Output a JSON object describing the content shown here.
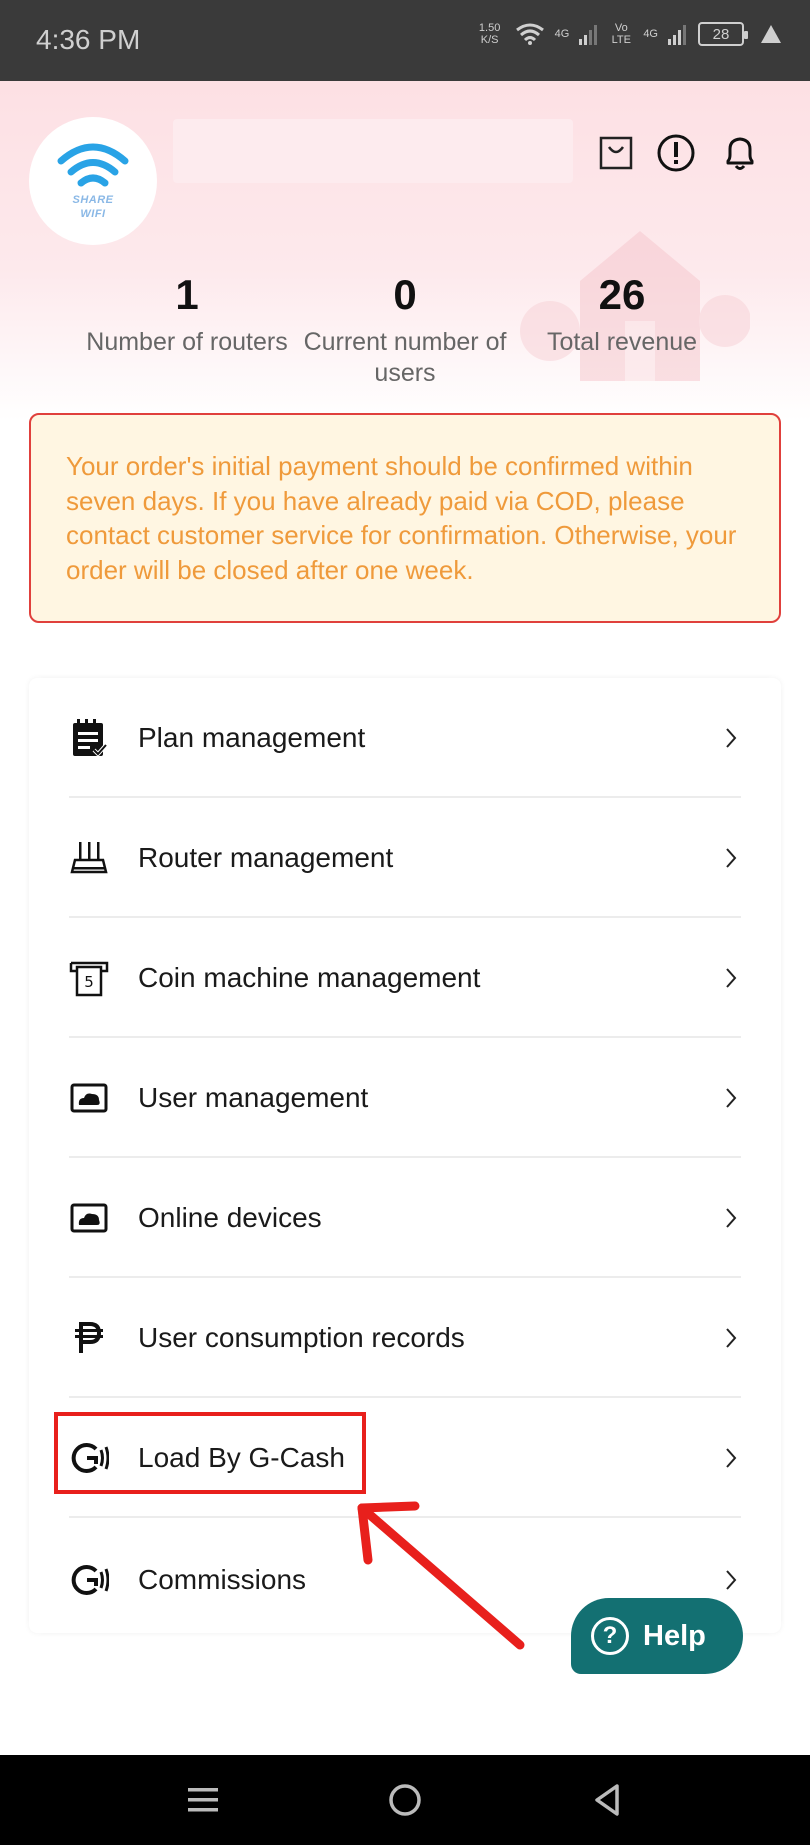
{
  "status_bar": {
    "time": "4:36 PM",
    "net_speed_value": "1.50",
    "net_speed_unit": "K/S",
    "sim1_label": "4G",
    "volte_label": "Vo LTE",
    "sim2_label": "4G",
    "battery": "28"
  },
  "header": {
    "logo_text_line1": "SHARE",
    "logo_text_line2": "WIFI",
    "icons": [
      "shopping-bag-icon",
      "alert-info-icon",
      "bell-icon"
    ]
  },
  "stats": [
    {
      "value": "1",
      "label": "Number of routers"
    },
    {
      "value": "0",
      "label": "Current number of users"
    },
    {
      "value": "26",
      "label": "Total revenue"
    }
  ],
  "notice": {
    "text": "Your order's initial payment should be confirmed within seven days. If you have already paid via COD, please contact customer service for confirmation. Otherwise, your order will be closed after one week."
  },
  "menu": [
    {
      "label": "Plan management",
      "icon": "plan-clipboard-icon"
    },
    {
      "label": "Router management",
      "icon": "router-icon"
    },
    {
      "label": "Coin machine management",
      "icon": "coin-machine-icon"
    },
    {
      "label": "User management",
      "icon": "user-cloud-icon"
    },
    {
      "label": "Online devices",
      "icon": "device-cloud-icon"
    },
    {
      "label": "User consumption records",
      "icon": "peso-icon"
    },
    {
      "label": "Load By G-Cash",
      "icon": "gcash-icon"
    },
    {
      "label": "Commissions",
      "icon": "gcash-icon"
    }
  ],
  "help_button": {
    "label": "Help"
  },
  "colors": {
    "notice_border": "#e0403c",
    "notice_text": "#ef9a3b",
    "help_button": "#137072",
    "annotation": "#e8201c"
  }
}
